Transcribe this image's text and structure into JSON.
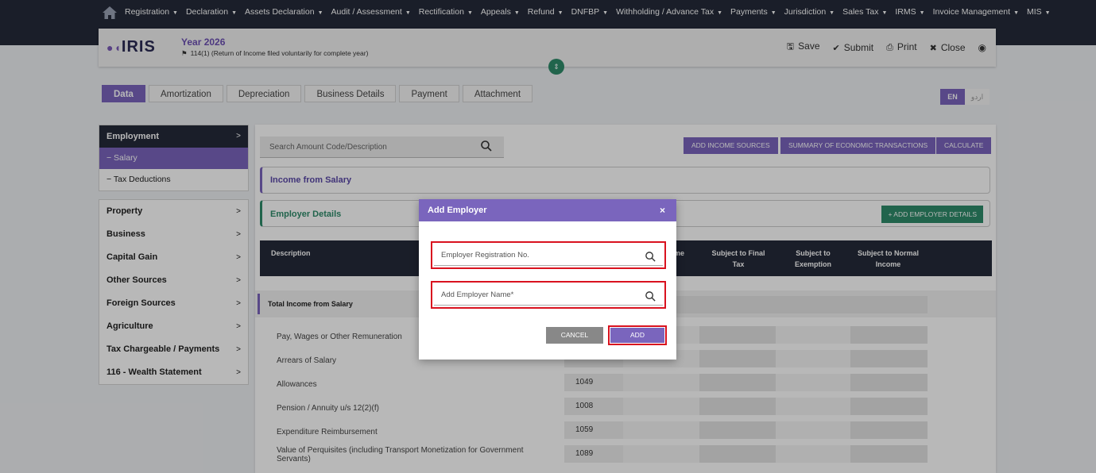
{
  "nav": {
    "items": [
      "Registration",
      "Declaration",
      "Assets Declaration",
      "Audit / Assessment",
      "Rectification",
      "Appeals",
      "Refund",
      "DNFBP",
      "Withholding / Advance Tax",
      "Payments",
      "Jurisdiction",
      "Sales Tax",
      "IRMS",
      "Invoice Management",
      "MIS"
    ]
  },
  "header": {
    "logo": "IRIS",
    "year": "Year 2026",
    "subtitle": "114(1) (Return of Income filed voluntarily for complete year)",
    "actions": {
      "save": "Save",
      "submit": "Submit",
      "print": "Print",
      "close": "Close"
    }
  },
  "tabs": [
    "Data",
    "Amortization",
    "Depreciation",
    "Business Details",
    "Payment",
    "Attachment"
  ],
  "lang": {
    "en": "EN",
    "ur": "اردو"
  },
  "sidebar": {
    "employment": "Employment",
    "salary": "− Salary",
    "tax_deductions": "− Tax Deductions",
    "items": [
      "Property",
      "Business",
      "Capital Gain",
      "Other Sources",
      "Foreign Sources",
      "Agriculture",
      "Tax Chargeable / Payments",
      "116 - Wealth Statement"
    ]
  },
  "main": {
    "search_placeholder": "Search Amount Code/Description",
    "btn_add_income": "ADD INCOME SOURCES",
    "btn_summary": "SUMMARY OF ECONOMIC TRANSACTIONS",
    "btn_calculate": "CALCULATE",
    "income_from_salary": "Income from Salary",
    "employer_details": "Employer Details",
    "btn_add_employer_details": "+ ADD EMPLOYER DETAILS",
    "table_headers": {
      "description": "Description",
      "me": "me",
      "final_tax": "Subject to Final Tax",
      "exemption": "Subject to Exemption",
      "normal": "Subject to Normal Income"
    },
    "total_label": "Total Income from Salary",
    "rows": [
      {
        "desc": "Pay, Wages or Other Remuneration",
        "code": ""
      },
      {
        "desc": "Arrears of Salary",
        "code": ""
      },
      {
        "desc": "Allowances",
        "code": "1049"
      },
      {
        "desc": "Pension / Annuity u/s 12(2)(f)",
        "code": "1008"
      },
      {
        "desc": "Expenditure Reimbursement",
        "code": "1059"
      },
      {
        "desc": "Value of Perquisites (including Transport Monetization for Government Servants)",
        "code": "1089"
      }
    ]
  },
  "modal": {
    "title": "Add Employer",
    "close": "×",
    "field_reg": "Employer Registration No.",
    "field_name": "Add Employer Name*",
    "cancel": "CANCEL",
    "add": "ADD"
  }
}
